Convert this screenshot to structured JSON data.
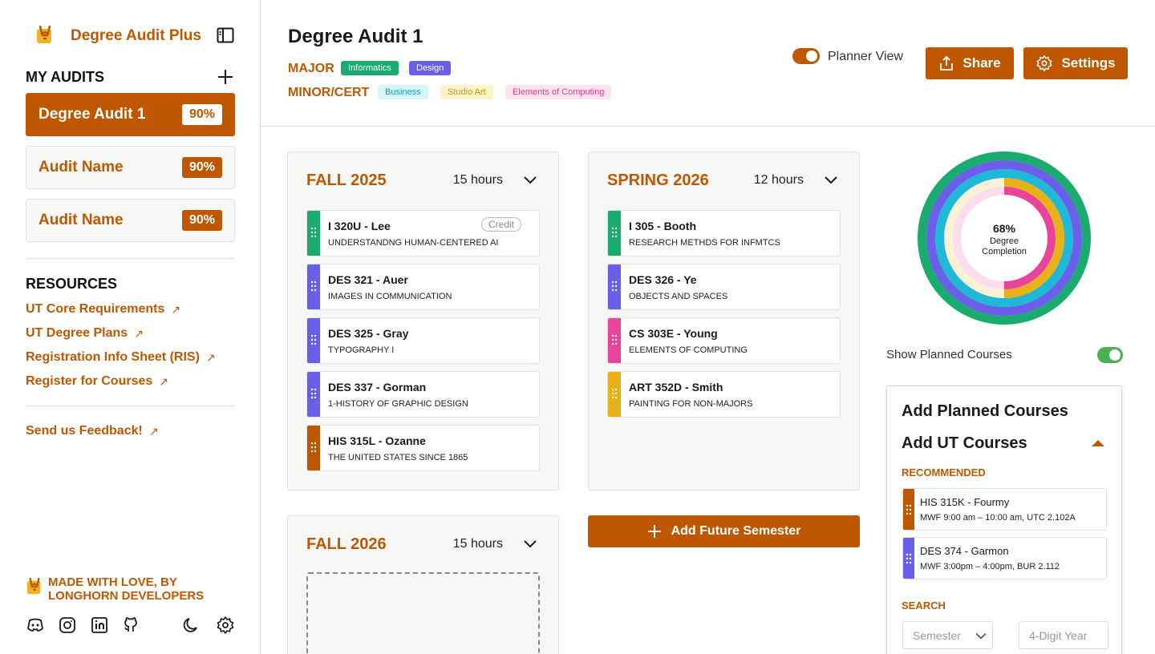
{
  "sidebar": {
    "brand": "Degree Audit Plus",
    "my_audits_title": "MY AUDITS",
    "audits": [
      {
        "name": "Degree Audit 1",
        "pct": "90%"
      },
      {
        "name": "Audit Name",
        "pct": "90%"
      },
      {
        "name": "Audit Name",
        "pct": "90%"
      }
    ],
    "resources_title": "RESOURCES",
    "resources": [
      {
        "label": "UT Core Requirements"
      },
      {
        "label": "UT Degree Plans"
      },
      {
        "label": "Registration Info Sheet (RIS)"
      },
      {
        "label": "Register for Courses"
      }
    ],
    "feedback": "Send us Feedback!",
    "footer_line1": "MADE WITH LOVE, BY",
    "footer_line2": "LONGHORN DEVELOPERS"
  },
  "header": {
    "title": "Degree Audit 1",
    "major_label": "MAJOR",
    "major_tags": [
      {
        "text": "Informatics",
        "bg": "#1aab6f",
        "fg": "#ffffff"
      },
      {
        "text": "Design",
        "bg": "#6a5fe8",
        "fg": "#ffffff"
      }
    ],
    "minor_label": "MINOR/CERT",
    "minor_tags": [
      {
        "text": "Business",
        "bg": "#d6f6fb",
        "fg": "#1a9ab8"
      },
      {
        "text": "Studio Art",
        "bg": "#fdf3c8",
        "fg": "#c8941a"
      },
      {
        "text": "Elements of Computing",
        "bg": "#fde2ef",
        "fg": "#e03e8a"
      }
    ],
    "planner_view_label": "Planner View",
    "share_label": "Share",
    "settings_label": "Settings"
  },
  "semesters": [
    {
      "title": "FALL 2025",
      "hours": "15 hours",
      "courses": [
        {
          "code": "I 320U - Lee",
          "name": "UNDERSTANDNG HUMAN-CENTERED AI",
          "color": "#1aab6f",
          "credit": "Credit"
        },
        {
          "code": "DES 321 - Auer",
          "name": "IMAGES IN COMMUNICATION",
          "color": "#6a5fe8"
        },
        {
          "code": "DES 325 - Gray",
          "name": "TYPOGRAPHY I",
          "color": "#6a5fe8"
        },
        {
          "code": "DES 337 - Gorman",
          "name": "1-HISTORY OF GRAPHIC DESIGN",
          "color": "#6a5fe8"
        },
        {
          "code": "HIS 315L - Ozanne",
          "name": "THE UNITED STATES SINCE 1865",
          "color": "#bf5700"
        }
      ]
    },
    {
      "title": "SPRING 2026",
      "hours": "12 hours",
      "courses": [
        {
          "code": "I 305 - Booth",
          "name": "RESEARCH METHDS FOR INFMTCS",
          "color": "#1aab6f"
        },
        {
          "code": "DES 326 - Ye",
          "name": "OBJECTS AND SPACES",
          "color": "#6a5fe8"
        },
        {
          "code": "CS 303E - Young",
          "name": "ELEMENTS OF COMPUTING",
          "color": "#e8449a"
        },
        {
          "code": "ART 352D - Smith",
          "name": "PAINTING FOR NON-MAJORS",
          "color": "#e8b11a"
        }
      ]
    },
    {
      "title": "FALL 2026",
      "hours": "15 hours",
      "courses": []
    }
  ],
  "add_future_semester": "Add Future Semester",
  "donut": {
    "pct": "68%",
    "label1": "Degree",
    "label2": "Completion"
  },
  "rings": [
    {
      "color": "#1aab6f",
      "fill": 1.0
    },
    {
      "color": "#6a5fe8",
      "fill": 1.0
    },
    {
      "color": "#1fb8d6",
      "fill": 1.0
    },
    {
      "color": "#e8b11a",
      "fill": 0.5
    },
    {
      "color": "#e8449a",
      "fill": 0.5
    }
  ],
  "show_planned_label": "Show Planned Courses",
  "panel": {
    "title": "Add Planned Courses",
    "subtitle": "Add UT Courses",
    "recommended_label": "RECOMMENDED",
    "recommended": [
      {
        "code": "HIS 315K - Fourmy",
        "time": "MWF 9:00 am – 10:00 am, UTC 2.102A",
        "color": "#bf5700"
      },
      {
        "code": "DES 374 - Garmon",
        "time": "MWF 3:00pm – 4:00pm, BUR 2.112",
        "color": "#6a5fe8"
      }
    ],
    "search_label": "SEARCH",
    "semester_placeholder": "Semester",
    "year_placeholder": "4-Digit Year"
  },
  "icons": [
    "longhorn-logo-icon",
    "sidebar-toggle-icon",
    "plus-icon",
    "external-link-icon",
    "discord-icon",
    "instagram-icon",
    "linkedin-icon",
    "github-icon",
    "moon-icon",
    "gear-icon",
    "share-icon",
    "chevron-down-icon",
    "drag-handle-icon",
    "caret-up-icon"
  ],
  "colors": {
    "accent": "#bf5700"
  }
}
